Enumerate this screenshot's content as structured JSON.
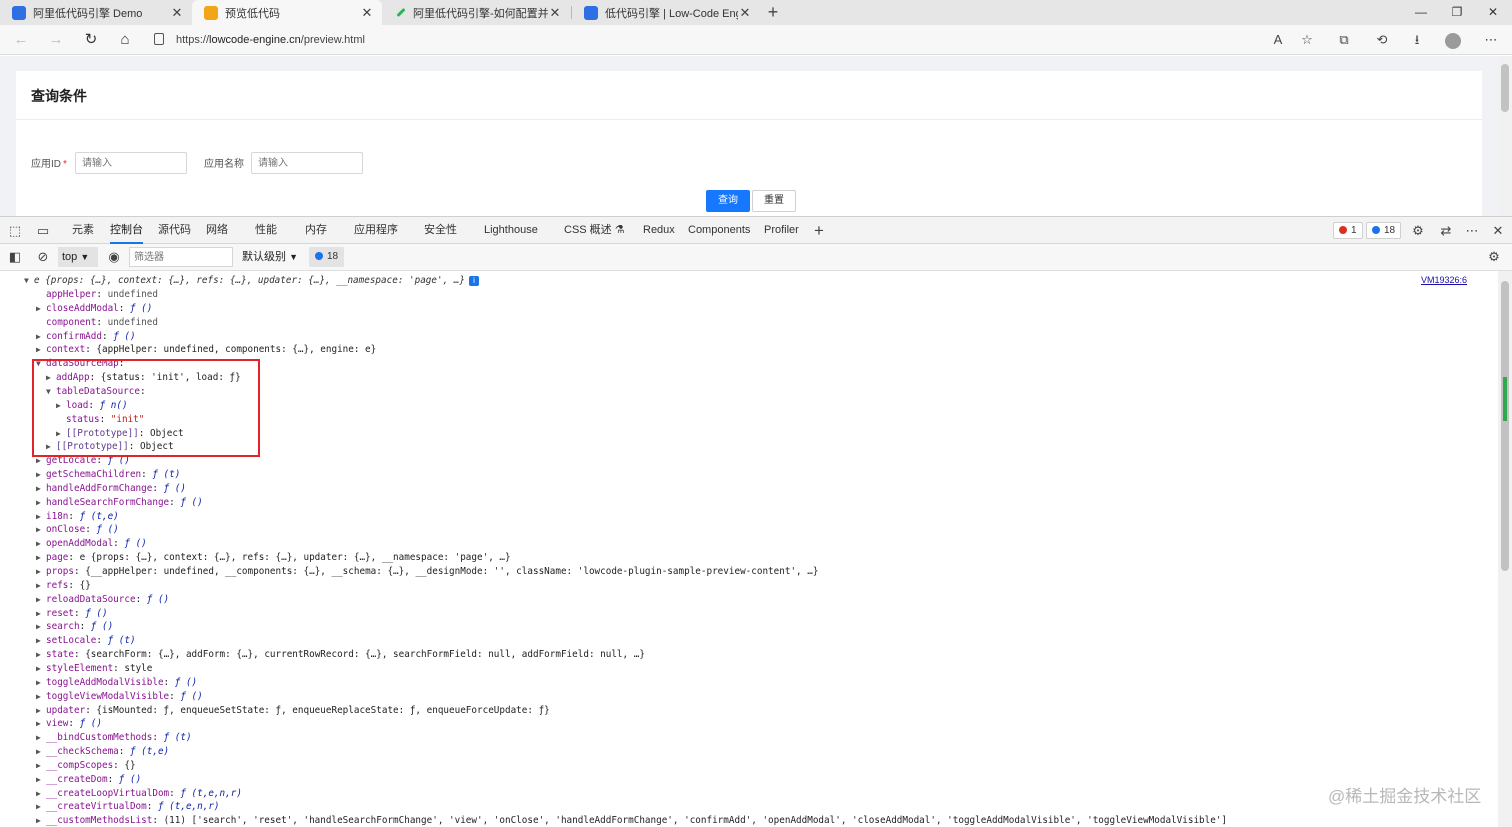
{
  "browser": {
    "tabs": [
      {
        "title": "阿里低代码引擎 Demo",
        "favicon_color": "#2f6fe4"
      },
      {
        "title": "预览低代码",
        "favicon_color": "#f2a516"
      },
      {
        "title": "阿里低代码引擎-如何配置并调用",
        "favicon_color": "#2db35e"
      },
      {
        "title": "低代码引擎 | Low-Code Engine",
        "favicon_color": "#2f6fe4"
      }
    ],
    "new_tab": "+",
    "window_controls": {
      "minimize": "—",
      "restore": "❐",
      "close": "✕"
    },
    "url_scheme": "https://",
    "url_host": "lowcode-engine.cn",
    "url_path": "/preview.html"
  },
  "page": {
    "card_title": "查询条件",
    "fields": [
      {
        "label": "应用ID",
        "required_mark": "*",
        "placeholder": "请输入"
      },
      {
        "label": "应用名称",
        "required_mark": "",
        "placeholder": "请输入"
      }
    ],
    "query_button": "查询",
    "reset_button": "重置"
  },
  "devtools": {
    "tabs": [
      "元素",
      "控制台",
      "源代码",
      "网络",
      "性能",
      "内存",
      "应用程序",
      "安全性",
      "Lighthouse",
      "CSS 概述",
      "Redux",
      "Components",
      "Profiler"
    ],
    "active_tab": "控制台",
    "error_count": "1",
    "message_count": "18",
    "context": "top",
    "filter_placeholder": "筛选器",
    "level": "默认级别",
    "issue_count": "18",
    "source_link": "VM19326:6"
  },
  "console": {
    "root_summary": "e {props: {…}, context: {…}, refs: {…}, updater: {…}, __namespace: 'page', …}",
    "lines": [
      {
        "indent": 0,
        "arrow": "",
        "key": "appHelper",
        "value": "undefined",
        "type": "dim"
      },
      {
        "indent": 0,
        "arrow": "▶",
        "key": "closeAddModal",
        "value": "ƒ ()",
        "type": "f"
      },
      {
        "indent": 0,
        "arrow": "",
        "key": "component",
        "value": "undefined",
        "type": "dim"
      },
      {
        "indent": 0,
        "arrow": "▶",
        "key": "confirmAdd",
        "value": "ƒ ()",
        "type": "f"
      },
      {
        "indent": 0,
        "arrow": "▶",
        "key": "context",
        "value": "{appHelper: undefined, components: {…}, engine: e}",
        "type": "plain"
      },
      {
        "indent": 0,
        "arrow": "▼",
        "key": "dataSourceMap",
        "value": "",
        "type": "plain"
      },
      {
        "indent": 1,
        "arrow": "▶",
        "key": "addApp",
        "value": "{status: 'init', load: ƒ}",
        "type": "plain"
      },
      {
        "indent": 1,
        "arrow": "▼",
        "key": "tableDataSource",
        "value": "",
        "type": "plain"
      },
      {
        "indent": 2,
        "arrow": "▶",
        "key": "load",
        "value": "ƒ n()",
        "type": "f"
      },
      {
        "indent": 2,
        "arrow": "",
        "key": "status",
        "value": "\"init\"",
        "type": "str"
      },
      {
        "indent": 2,
        "arrow": "▶",
        "key": "[[Prototype]]",
        "value": "Object",
        "type": "plain",
        "proto": true
      },
      {
        "indent": 1,
        "arrow": "▶",
        "key": "[[Prototype]]",
        "value": "Object",
        "type": "plain",
        "proto": true
      },
      {
        "indent": 0,
        "arrow": "▶",
        "key": "getLocale",
        "value": "ƒ ()",
        "type": "f"
      },
      {
        "indent": 0,
        "arrow": "▶",
        "key": "getSchemaChildren",
        "value": "ƒ (t)",
        "type": "f"
      },
      {
        "indent": 0,
        "arrow": "▶",
        "key": "handleAddFormChange",
        "value": "ƒ ()",
        "type": "f"
      },
      {
        "indent": 0,
        "arrow": "▶",
        "key": "handleSearchFormChange",
        "value": "ƒ ()",
        "type": "f"
      },
      {
        "indent": 0,
        "arrow": "▶",
        "key": "i18n",
        "value": "ƒ (t,e)",
        "type": "f"
      },
      {
        "indent": 0,
        "arrow": "▶",
        "key": "onClose",
        "value": "ƒ ()",
        "type": "f"
      },
      {
        "indent": 0,
        "arrow": "▶",
        "key": "openAddModal",
        "value": "ƒ ()",
        "type": "f"
      },
      {
        "indent": 0,
        "arrow": "▶",
        "key": "page",
        "value": "e {props: {…}, context: {…}, refs: {…}, updater: {…}, __namespace: 'page', …}",
        "type": "plain"
      },
      {
        "indent": 0,
        "arrow": "▶",
        "key": "props",
        "value": "{__appHelper: undefined, __components: {…}, __schema: {…}, __designMode: '', className: 'lowcode-plugin-sample-preview-content', …}",
        "type": "plain"
      },
      {
        "indent": 0,
        "arrow": "▶",
        "key": "refs",
        "value": "{}",
        "type": "plain"
      },
      {
        "indent": 0,
        "arrow": "▶",
        "key": "reloadDataSource",
        "value": "ƒ ()",
        "type": "f"
      },
      {
        "indent": 0,
        "arrow": "▶",
        "key": "reset",
        "value": "ƒ ()",
        "type": "f"
      },
      {
        "indent": 0,
        "arrow": "▶",
        "key": "search",
        "value": "ƒ ()",
        "type": "f"
      },
      {
        "indent": 0,
        "arrow": "▶",
        "key": "setLocale",
        "value": "ƒ (t)",
        "type": "f"
      },
      {
        "indent": 0,
        "arrow": "▶",
        "key": "state",
        "value": "{searchForm: {…}, addForm: {…}, currentRowRecord: {…}, searchFormField: null, addFormField: null, …}",
        "type": "plain"
      },
      {
        "indent": 0,
        "arrow": "▶",
        "key": "styleElement",
        "value": "style",
        "type": "plain"
      },
      {
        "indent": 0,
        "arrow": "▶",
        "key": "toggleAddModalVisible",
        "value": "ƒ ()",
        "type": "f"
      },
      {
        "indent": 0,
        "arrow": "▶",
        "key": "toggleViewModalVisible",
        "value": "ƒ ()",
        "type": "f"
      },
      {
        "indent": 0,
        "arrow": "▶",
        "key": "updater",
        "value": "{isMounted: ƒ, enqueueSetState: ƒ, enqueueReplaceState: ƒ, enqueueForceUpdate: ƒ}",
        "type": "plain"
      },
      {
        "indent": 0,
        "arrow": "▶",
        "key": "view",
        "value": "ƒ ()",
        "type": "f"
      },
      {
        "indent": 0,
        "arrow": "▶",
        "key": "__bindCustomMethods",
        "value": "ƒ (t)",
        "type": "f"
      },
      {
        "indent": 0,
        "arrow": "▶",
        "key": "__checkSchema",
        "value": "ƒ (t,e)",
        "type": "f"
      },
      {
        "indent": 0,
        "arrow": "▶",
        "key": "__compScopes",
        "value": "{}",
        "type": "plain"
      },
      {
        "indent": 0,
        "arrow": "▶",
        "key": "__createDom",
        "value": "ƒ ()",
        "type": "f"
      },
      {
        "indent": 0,
        "arrow": "▶",
        "key": "__createLoopVirtualDom",
        "value": "ƒ (t,e,n,r)",
        "type": "f"
      },
      {
        "indent": 0,
        "arrow": "▶",
        "key": "__createVirtualDom",
        "value": "ƒ (t,e,n,r)",
        "type": "f"
      },
      {
        "indent": 0,
        "arrow": "▶",
        "key": "__customMethodsList",
        "value": "(11) ['search', 'reset', 'handleSearchFormChange', 'view', 'onClose', 'handleAddFormChange', 'confirmAdd', 'openAddModal', 'closeAddModal', 'toggleAddModalVisible', 'toggleViewModalVisible']",
        "type": "plain"
      }
    ]
  },
  "watermark": "@稀土掘金技术社区"
}
